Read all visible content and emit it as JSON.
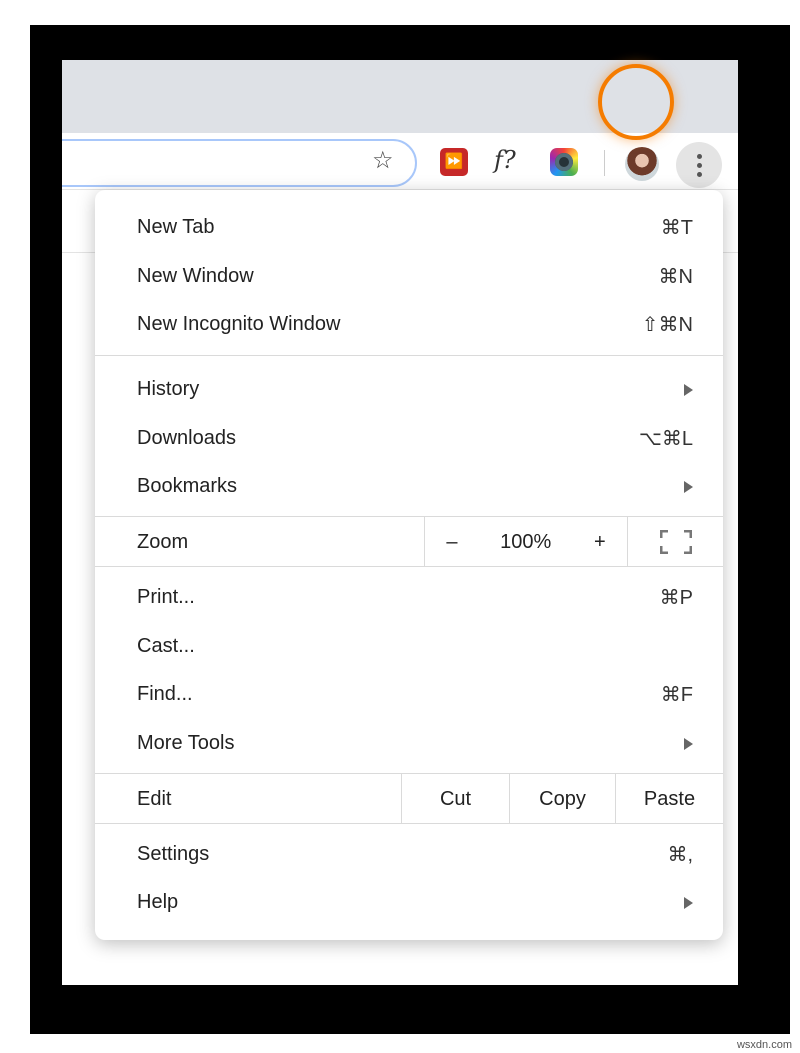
{
  "toolbar": {
    "star_icon": "bookmark-star",
    "extensions": [
      "fast-forward-extension",
      "font-question-extension",
      "camera-extension"
    ],
    "menu_button": "more-vert"
  },
  "menu": {
    "group1": [
      {
        "label": "New Tab",
        "shortcut": "⌘T"
      },
      {
        "label": "New Window",
        "shortcut": "⌘N"
      },
      {
        "label": "New Incognito Window",
        "shortcut": "⇧⌘N"
      }
    ],
    "group2": [
      {
        "label": "History",
        "shortcut": ""
      },
      {
        "label": "Downloads",
        "shortcut": "⌥⌘L"
      },
      {
        "label": "Bookmarks",
        "shortcut": ""
      }
    ],
    "zoom": {
      "label": "Zoom",
      "minus": "–",
      "value": "100%",
      "plus": "+"
    },
    "group3": [
      {
        "label": "Print...",
        "shortcut": "⌘P"
      },
      {
        "label": "Cast...",
        "shortcut": ""
      },
      {
        "label": "Find...",
        "shortcut": "⌘F"
      },
      {
        "label": "More Tools",
        "shortcut": ""
      }
    ],
    "edit": {
      "label": "Edit",
      "cut": "Cut",
      "copy": "Copy",
      "paste": "Paste"
    },
    "group4": [
      {
        "label": "Settings",
        "shortcut": "⌘,"
      },
      {
        "label": "Help",
        "shortcut": ""
      }
    ]
  },
  "highlight_color": "#f57c00",
  "watermark": "wsxdn.com"
}
